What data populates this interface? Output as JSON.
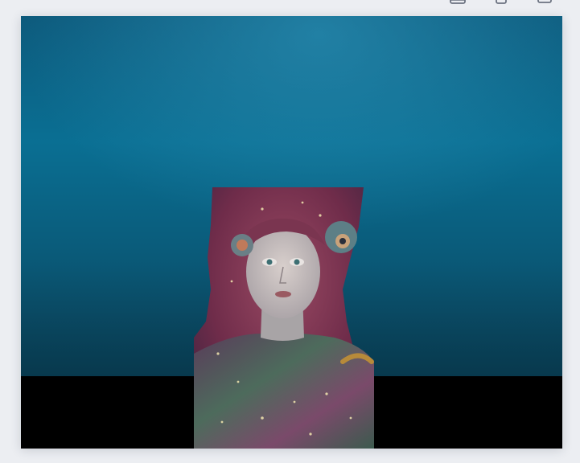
{
  "toolbar": {
    "icons": [
      "crop-icon",
      "phone-icon",
      "screen-icon"
    ]
  },
  "image": {
    "subject": "underwater-portrait",
    "colors": {
      "water_top": "#0d5a7c",
      "water_mid": "#0a6f93",
      "water_bottom": "#0a3f55",
      "letterbox": "#000000",
      "hair": "#7a3550",
      "skin": "#c9c0bf"
    }
  }
}
